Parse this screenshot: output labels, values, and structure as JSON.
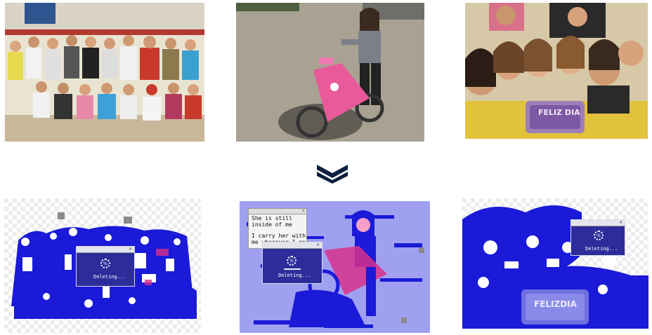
{
  "originals": {
    "photo1": {
      "icon": "group-of-children-photo"
    },
    "photo2": {
      "icon": "girl-on-bicycle-photo"
    },
    "photo3": {
      "icon": "children-with-cake-photo"
    },
    "cake_text": "FELIZ DIA"
  },
  "arrow": {
    "icon": "double-chevron-down-icon"
  },
  "glitched": {
    "dialog1": {
      "percent": "%",
      "status": "Deleting..."
    },
    "dialog2": {
      "percent": "%",
      "status": "Deleting..."
    },
    "dialog3": {
      "percent": "%",
      "status": "Deleting..."
    },
    "note": {
      "lines": [
        "She is still",
        "inside of me",
        "",
        "I carry her with",
        "me wherever I go"
      ]
    },
    "cake_text": "FELIZDIA"
  },
  "colors": {
    "glitch_blue": "#1a1ad8",
    "dialog_blue": "#2c2c9a",
    "white": "#ffffff"
  }
}
